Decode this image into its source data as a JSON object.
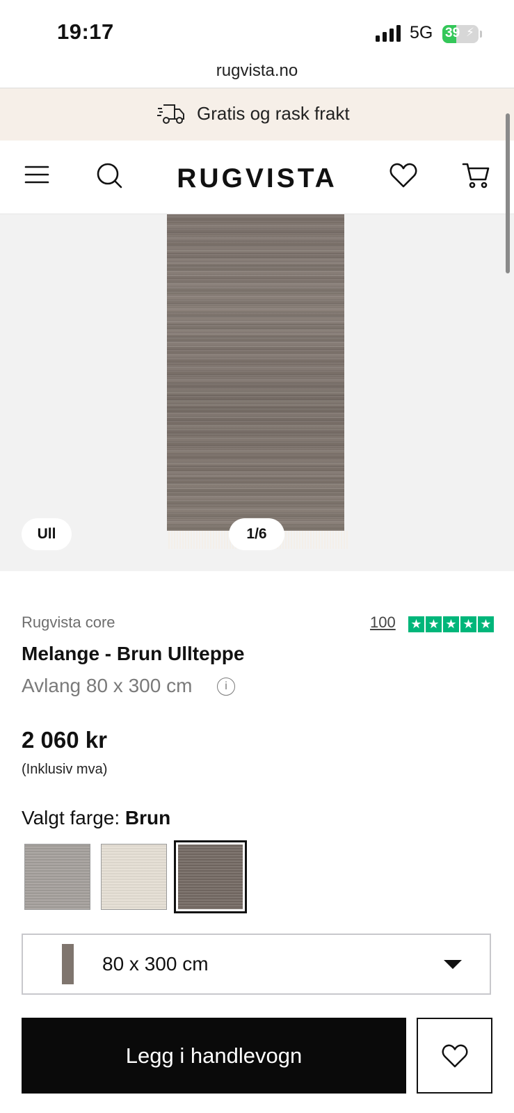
{
  "status_bar": {
    "time": "19:17",
    "network": "5G",
    "battery": "39",
    "battery_level_percent": 39
  },
  "browser": {
    "url": "rugvista.no"
  },
  "promo": {
    "text": "Gratis og rask frakt",
    "icon": "delivery-truck-icon"
  },
  "header": {
    "logo": "RUGVISTA",
    "icons": [
      "menu-icon",
      "search-icon",
      "heart-icon",
      "cart-icon"
    ]
  },
  "gallery": {
    "material_badge": "Ull",
    "counter": "1/6"
  },
  "product": {
    "brand": "Rugvista core",
    "review_count": "100",
    "rating_stars": 5,
    "title": "Melange - Brun Ullteppe",
    "size_text": "Avlang 80 x 300 cm",
    "price": "2 060 kr",
    "vat_note": "(Inklusiv mva)",
    "color_label": "Valgt farge:",
    "color_value": "Brun",
    "swatches": [
      "grey",
      "beige",
      "brown"
    ],
    "selected_swatch": "brown",
    "size_select_value": "80 x 300 cm"
  },
  "actions": {
    "add_to_cart": "Legg i handlevogn"
  },
  "colors": {
    "trustpilot_green": "#00b67a",
    "promo_bg": "#f6efe8",
    "button_black": "#0a0a0a"
  }
}
